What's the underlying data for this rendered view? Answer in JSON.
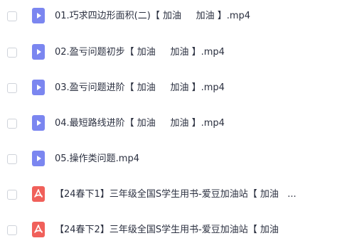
{
  "files": [
    {
      "name": "01.巧求四边形面积(二)【 加油     加油 】.mp4",
      "icon": "video-file-icon"
    },
    {
      "name": "02.盈亏问题初步【 加油     加油 】.mp4",
      "icon": "video-file-icon"
    },
    {
      "name": "03.盈亏问题进阶【 加油     加油 】.mp4",
      "icon": "video-file-icon"
    },
    {
      "name": "04.最短路线进阶【 加油     加油 】.mp4",
      "icon": "video-file-icon"
    },
    {
      "name": "05.操作类问题.mp4",
      "icon": "video-file-icon"
    },
    {
      "name": "【24春下1】三年级全国S学生用书-爱豆加油站【 加油   ...",
      "icon": "pdf-file-icon"
    },
    {
      "name": "【24春下2】三年级全国S学生用书-爱豆加油站【 加油",
      "icon": "pdf-file-icon"
    }
  ],
  "colors": {
    "video_icon": "#7b86f0",
    "pdf_icon": "#f0605a",
    "text": "#2b3040",
    "checkbox_border": "#cfd3da"
  }
}
